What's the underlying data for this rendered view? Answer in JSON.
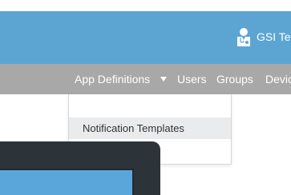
{
  "header": {
    "user_name": "GSI Te",
    "user_icon": "doctor-user-icon"
  },
  "nav": {
    "app_definitions": "App Definitions",
    "users": "Users",
    "groups": "Groups",
    "devices": "Devic"
  },
  "dropdown": {
    "items": [
      {
        "label": "Notification Templates"
      }
    ]
  },
  "colors": {
    "header_bg": "#5ca5d3",
    "nav_bg": "#a8a8a8",
    "dropdown_hover": "#e9ebed",
    "device_frame": "#2d3439",
    "device_screen": "#5aa6da"
  }
}
